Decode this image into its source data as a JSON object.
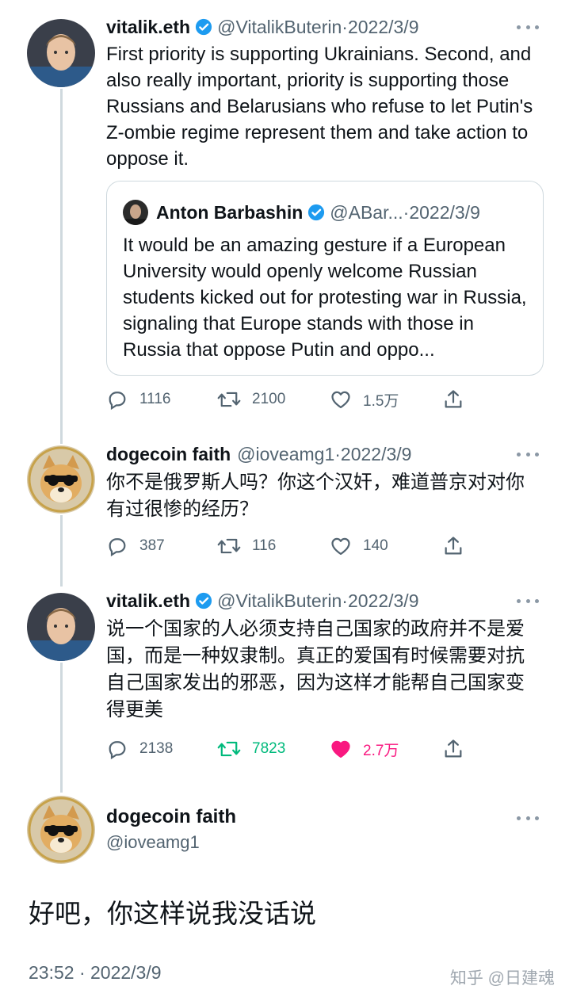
{
  "tweets": [
    {
      "name": "vitalik.eth",
      "handle": "@VitalikButerin",
      "sep": " · ",
      "date": "2022/3/9",
      "text": "First priority is supporting Ukrainians. Second, and also really important, priority is supporting those Russians and Belarusians who refuse to let Putin's Z-ombie regime represent them and take action to oppose it.",
      "quote": {
        "name": "Anton Barbashin",
        "handle": "@ABar...",
        "sep": " · ",
        "date": "2022/3/9",
        "text": "It would be an amazing gesture if a European University would openly welcome Russian students kicked out for protesting war in Russia, signaling that Europe stands with those in Russia that oppose Putin and oppo..."
      },
      "replies": "1116",
      "retweets": "2100",
      "likes": "1.5万"
    },
    {
      "name": "dogecoin faith",
      "handle": "@ioveamg1",
      "sep": " · ",
      "date": "2022/3/9",
      "text": "你不是俄罗斯人吗？你这个汉奸，难道普京对对你有过很惨的经历？",
      "replies": "387",
      "retweets": "116",
      "likes": "140"
    },
    {
      "name": "vitalik.eth",
      "handle": "@VitalikButerin",
      "sep": " · ",
      "date": "2022/3/9",
      "text": "说一个国家的人必须支持自己国家的政府并不是爱国，而是一种奴隶制。真正的爱国有时候需要对抗自己国家发出的邪恶，因为这样才能帮自己国家变得更美",
      "replies": "2138",
      "retweets": "7823",
      "likes": "2.7万"
    }
  ],
  "detail": {
    "name": "dogecoin faith",
    "handle": "@ioveamg1",
    "text": "好吧，你这样说我没话说",
    "time": "23:52 · 2022/3/9"
  },
  "watermark": "知乎 @日建魂",
  "colors": {
    "text": "#0f1419",
    "secondary": "#536471",
    "verified": "#1d9bf0",
    "retweet_active": "#00ba7c",
    "like_active": "#f91880",
    "thread_line": "#cfd9de"
  }
}
